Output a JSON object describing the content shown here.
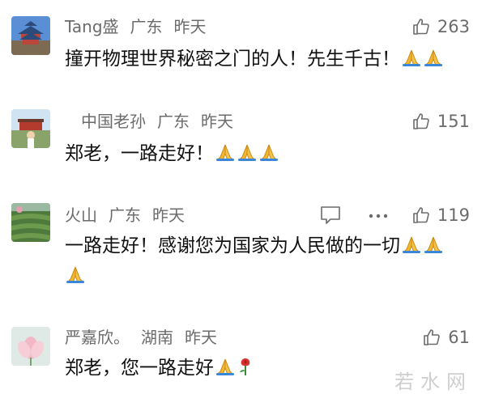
{
  "comments": [
    {
      "username": "Tang盛",
      "region": "广东",
      "time": "昨天",
      "likes": "263",
      "text": "撞开物理世界秘密之门的人！先生千古！",
      "emoji_count": 2
    },
    {
      "username": "中国老孙",
      "region": "广东",
      "time": "昨天",
      "likes": "151",
      "text": "郑老，一路走好！",
      "emoji_count": 3
    },
    {
      "username": "火山",
      "region": "广东",
      "time": "昨天",
      "likes": "119",
      "text": "一路走好！感谢您为国家为人民做的一切",
      "emoji_count": 3
    },
    {
      "username": "严嘉欣。",
      "region": "湖南",
      "time": "昨天",
      "likes": "61",
      "text": "郑老，您一路走好",
      "emoji_count": 1
    }
  ],
  "icons": {
    "like": "thumbs-up-icon",
    "reply": "comment-bubble-icon",
    "more": "more-dots-icon",
    "pray": "folded-hands-emoji",
    "rose": "rose-emoji"
  },
  "watermark": "若水网"
}
